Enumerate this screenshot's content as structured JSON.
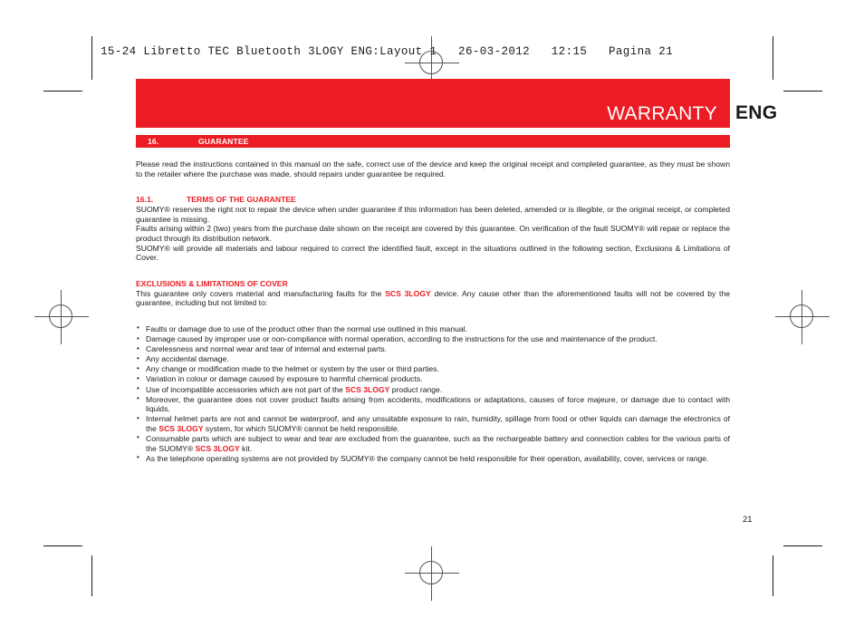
{
  "prepress": {
    "slug_line": "15-24 Libretto TEC Bluetooth 3LOGY ENG:Layout 1   26-03-2012   12:15   Pagina 21"
  },
  "header": {
    "title": "WARRANTY",
    "language_tag": "ENG",
    "banner_color": "#ec1c24"
  },
  "section": {
    "number": "16.",
    "label": "GUARANTEE"
  },
  "intro": {
    "paragraph": "Please read the instructions contained in this manual on the safe, correct use of the device and keep the original receipt and completed guarantee, as they must be shown to the retailer where the purchase was made, should repairs under guarantee be required."
  },
  "terms": {
    "number": "16.1.",
    "label": "TERMS OF THE GUARANTEE",
    "paragraph_1": "SUOMY® reserves the right not to repair the device when under guarantee if this information has been deleted, amended or is illegible, or the original receipt, or completed guarantee is missing.",
    "paragraph_2": "Faults arising within 2 (two) years from the purchase date shown on the receipt are covered by this guarantee. On verification of the fault SUOMY® will repair or replace the product through its distribution network.",
    "paragraph_3": "SUOMY® will provide all materials and labour required to correct the identified fault, except in the situations outlined in the following section, Exclusions & Limitations of Cover."
  },
  "exclusions": {
    "label": "EXCLUSIONS & LIMITATIONS OF COVER",
    "intro_part_1": "This guarantee only covers material and manufacturing faults for the ",
    "intro_brand": "SCS 3LOGY",
    "intro_part_2": " device. Any cause other than the aforementioned faults will not be covered by the guarantee, including but not limited to:",
    "items": [
      {
        "parts": [
          {
            "text": "Faults or damage due to use of the product other than the normal use outlined in this manual.",
            "style": "normal"
          }
        ]
      },
      {
        "parts": [
          {
            "text": "Damage caused by improper use or non-compliance with normal operation, according to the instructions for the use and maintenance of the product.",
            "style": "normal"
          }
        ]
      },
      {
        "parts": [
          {
            "text": "Carelessness and normal wear and tear of internal and external parts.",
            "style": "normal"
          }
        ]
      },
      {
        "parts": [
          {
            "text": "Any accidental damage.",
            "style": "normal"
          }
        ]
      },
      {
        "parts": [
          {
            "text": "Any change or modification made to the helmet or system by the user or third parties.",
            "style": "normal"
          }
        ]
      },
      {
        "parts": [
          {
            "text": "Variation in colour or damage caused by exposure to harmful chemical products.",
            "style": "normal"
          }
        ]
      },
      {
        "parts": [
          {
            "text": "Use of incompatible accessories which are not part of the ",
            "style": "normal"
          },
          {
            "text": "SCS 3LOGY",
            "style": "red"
          },
          {
            "text": " product range.",
            "style": "normal"
          }
        ]
      },
      {
        "parts": [
          {
            "text": "Moreover, the guarantee does not cover product faults arising from accidents, modifications or adaptations, causes of force majeure, or damage due to contact with liquids.",
            "style": "normal"
          }
        ]
      },
      {
        "parts": [
          {
            "text": "Internal helmet parts are not and cannot be waterproof, and any unsuitable exposure to rain, humidity, spillage from food or other liquids can damage the electronics of the ",
            "style": "normal"
          },
          {
            "text": "SCS 3LOGY",
            "style": "red"
          },
          {
            "text": " system, for which SUOMY® cannot be held responsible.",
            "style": "normal"
          }
        ]
      },
      {
        "parts": [
          {
            "text": "Consumable parts which are subject to wear and tear are excluded from the guarantee, such as the rechargeable battery and connection cables for the various parts of the SUOMY® ",
            "style": "normal"
          },
          {
            "text": "SCS 3LOGY",
            "style": "red"
          },
          {
            "text": " kit.",
            "style": "normal"
          }
        ]
      },
      {
        "parts": [
          {
            "text": "As the telephone operating systems are not provided by SUOMY® the company cannot be held responsible for their operation, availability, cover, services or range.",
            "style": "normal"
          }
        ]
      }
    ]
  },
  "footer": {
    "page_number": "21"
  }
}
